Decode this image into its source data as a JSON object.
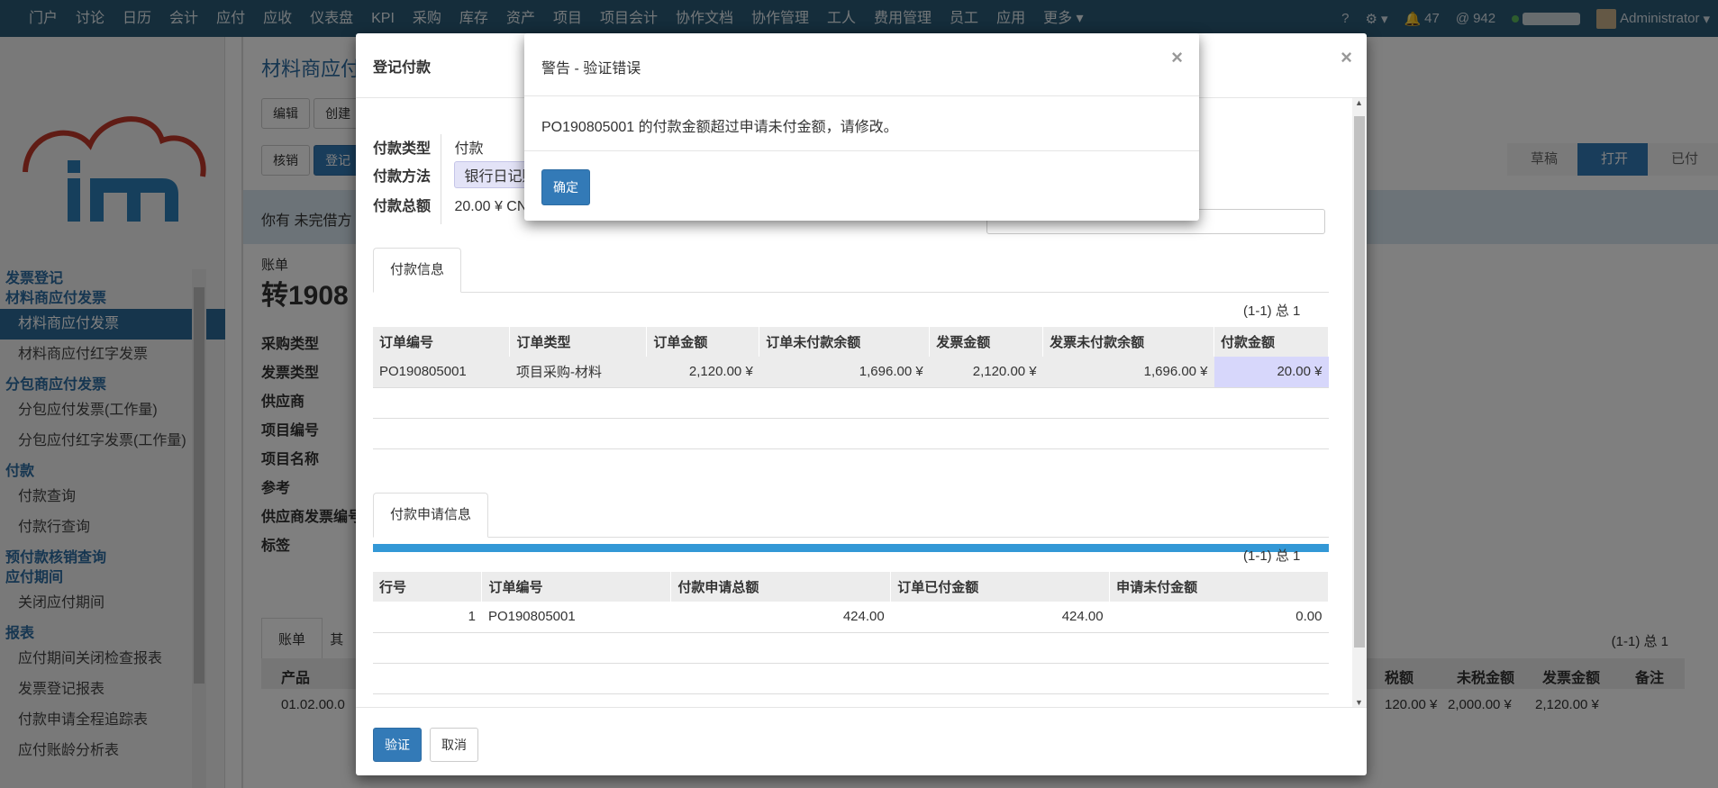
{
  "topnav": {
    "items": [
      "门户",
      "讨论",
      "日历",
      "会计",
      "应付",
      "应收",
      "仪表盘",
      "KPI",
      "采购",
      "库存",
      "资产",
      "项目",
      "项目会计",
      "协作文档",
      "协作管理",
      "工人",
      "费用管理",
      "员工",
      "应用",
      "更多"
    ],
    "help": "?",
    "notifications": "47",
    "mentions": "942",
    "user": "Administrator"
  },
  "sidebar": {
    "groups": [
      {
        "header": "发票登记",
        "items": []
      },
      {
        "header": "材料商应付发票",
        "items": [
          "材料商应付发票",
          "材料商应付红字发票"
        ]
      },
      {
        "header": "分包商应付发票",
        "items": [
          "分包应付发票(工作量)",
          "分包应付红字发票(工作量)"
        ]
      },
      {
        "header": "付款",
        "items": [
          "付款查询",
          "付款行查询"
        ]
      },
      {
        "header": "预付款核销查询",
        "items": []
      },
      {
        "header": "应付期间",
        "items": [
          "关闭应付期间"
        ]
      },
      {
        "header": "报表",
        "items": [
          "应付期间关闭检查报表",
          "发票登记报表",
          "付款申请全程追踪表",
          "应付账龄分析表"
        ]
      }
    ],
    "active_item": "材料商应付发票"
  },
  "main": {
    "title": "材料商应付",
    "buttons": [
      "编辑",
      "创建"
    ],
    "action_buttons": [
      "核销",
      "登记"
    ],
    "status_steps": [
      "草稿",
      "打开",
      "已付"
    ],
    "current_status": "打开",
    "info_text": "你有 未完借方",
    "bill_label": "账单",
    "bill_number": "转1908",
    "fields": [
      "采购类型",
      "发票类型",
      "供应商",
      "项目编号",
      "项目名称",
      "参考",
      "供应商发票编号",
      "标签"
    ],
    "tabs": [
      "账单",
      "其"
    ],
    "bg_pager": "(1-1) 总 1",
    "bg_table_headers": [
      "产品",
      "税额",
      "未税金额",
      "发票金额",
      "备注"
    ],
    "bg_row": {
      "product": "01.02.00.0",
      "tax": "120.00 ¥",
      "untaxed": "2,000.00 ¥",
      "invoice": "2,120.00 ¥"
    }
  },
  "dialog": {
    "title": "登记付款",
    "payment_type_label": "付款类型",
    "payment_type_value": "付款",
    "payment_method_label": "付款方法",
    "payment_method_value": "银行日记账",
    "payment_total_label": "付款总额",
    "payment_total_value": "20.00 ¥ CNY",
    "tab1": "付款信息",
    "pager1": "(1-1) 总 1",
    "table1": {
      "headers": [
        "订单编号",
        "订单类型",
        "订单金额",
        "订单未付款余额",
        "发票金额",
        "发票未付款余额",
        "付款金额"
      ],
      "rows": [
        [
          "PO190805001",
          "项目采购-材料",
          "2,120.00 ¥",
          "1,696.00 ¥",
          "2,120.00 ¥",
          "1,696.00 ¥",
          "20.00 ¥"
        ]
      ]
    },
    "tab2": "付款申请信息",
    "pager2": "(1-1) 总 1",
    "table2": {
      "headers": [
        "行号",
        "订单编号",
        "付款申请总额",
        "订单已付金额",
        "申请未付金额"
      ],
      "rows": [
        [
          "1",
          "PO190805001",
          "424.00",
          "424.00",
          "0.00"
        ]
      ]
    },
    "validate_button": "验证",
    "cancel_button": "取消"
  },
  "warning": {
    "title": "警告 - 验证错误",
    "message": "PO190805001 的付款金额超过申请未付金额，请修改。",
    "ok_button": "确定"
  },
  "colors": {
    "nav": "#2b5a77",
    "primary": "#337ab7",
    "sidebar_header": "#2d6ca2"
  }
}
